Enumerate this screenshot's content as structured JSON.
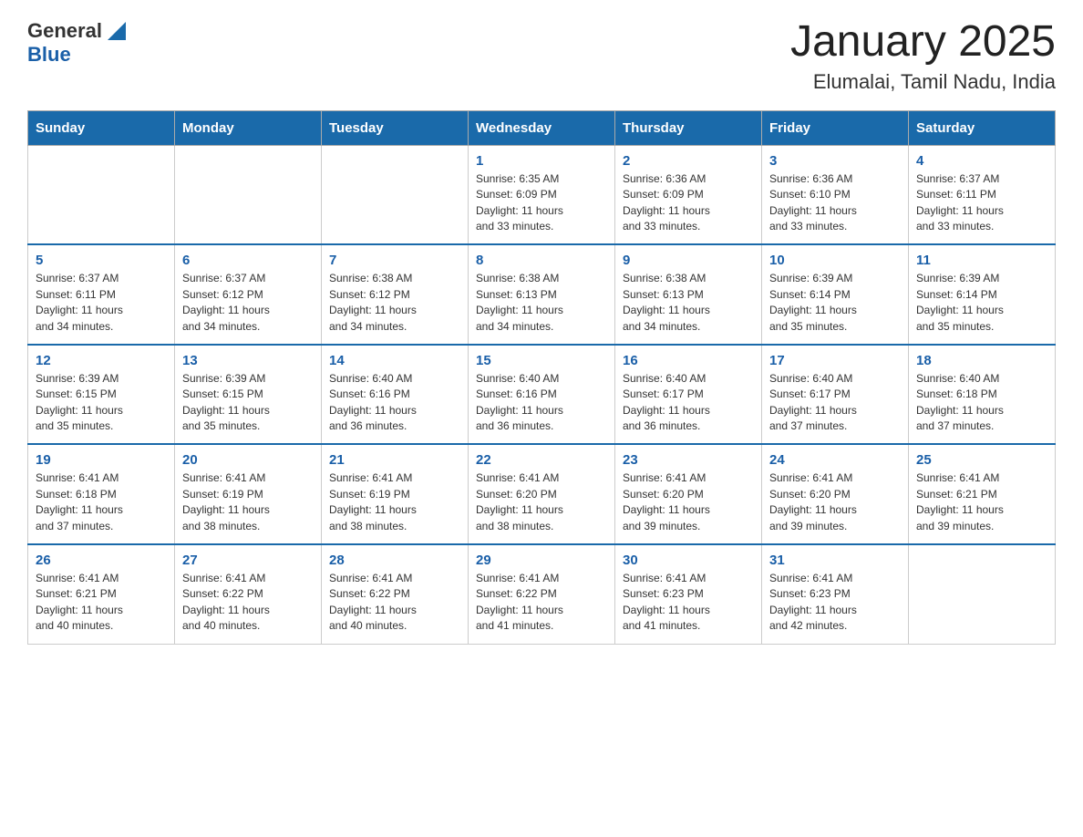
{
  "header": {
    "logo_general": "General",
    "logo_blue": "Blue",
    "title": "January 2025",
    "subtitle": "Elumalai, Tamil Nadu, India"
  },
  "weekdays": [
    "Sunday",
    "Monday",
    "Tuesday",
    "Wednesday",
    "Thursday",
    "Friday",
    "Saturday"
  ],
  "weeks": [
    [
      {
        "day": "",
        "info": ""
      },
      {
        "day": "",
        "info": ""
      },
      {
        "day": "",
        "info": ""
      },
      {
        "day": "1",
        "info": "Sunrise: 6:35 AM\nSunset: 6:09 PM\nDaylight: 11 hours\nand 33 minutes."
      },
      {
        "day": "2",
        "info": "Sunrise: 6:36 AM\nSunset: 6:09 PM\nDaylight: 11 hours\nand 33 minutes."
      },
      {
        "day": "3",
        "info": "Sunrise: 6:36 AM\nSunset: 6:10 PM\nDaylight: 11 hours\nand 33 minutes."
      },
      {
        "day": "4",
        "info": "Sunrise: 6:37 AM\nSunset: 6:11 PM\nDaylight: 11 hours\nand 33 minutes."
      }
    ],
    [
      {
        "day": "5",
        "info": "Sunrise: 6:37 AM\nSunset: 6:11 PM\nDaylight: 11 hours\nand 34 minutes."
      },
      {
        "day": "6",
        "info": "Sunrise: 6:37 AM\nSunset: 6:12 PM\nDaylight: 11 hours\nand 34 minutes."
      },
      {
        "day": "7",
        "info": "Sunrise: 6:38 AM\nSunset: 6:12 PM\nDaylight: 11 hours\nand 34 minutes."
      },
      {
        "day": "8",
        "info": "Sunrise: 6:38 AM\nSunset: 6:13 PM\nDaylight: 11 hours\nand 34 minutes."
      },
      {
        "day": "9",
        "info": "Sunrise: 6:38 AM\nSunset: 6:13 PM\nDaylight: 11 hours\nand 34 minutes."
      },
      {
        "day": "10",
        "info": "Sunrise: 6:39 AM\nSunset: 6:14 PM\nDaylight: 11 hours\nand 35 minutes."
      },
      {
        "day": "11",
        "info": "Sunrise: 6:39 AM\nSunset: 6:14 PM\nDaylight: 11 hours\nand 35 minutes."
      }
    ],
    [
      {
        "day": "12",
        "info": "Sunrise: 6:39 AM\nSunset: 6:15 PM\nDaylight: 11 hours\nand 35 minutes."
      },
      {
        "day": "13",
        "info": "Sunrise: 6:39 AM\nSunset: 6:15 PM\nDaylight: 11 hours\nand 35 minutes."
      },
      {
        "day": "14",
        "info": "Sunrise: 6:40 AM\nSunset: 6:16 PM\nDaylight: 11 hours\nand 36 minutes."
      },
      {
        "day": "15",
        "info": "Sunrise: 6:40 AM\nSunset: 6:16 PM\nDaylight: 11 hours\nand 36 minutes."
      },
      {
        "day": "16",
        "info": "Sunrise: 6:40 AM\nSunset: 6:17 PM\nDaylight: 11 hours\nand 36 minutes."
      },
      {
        "day": "17",
        "info": "Sunrise: 6:40 AM\nSunset: 6:17 PM\nDaylight: 11 hours\nand 37 minutes."
      },
      {
        "day": "18",
        "info": "Sunrise: 6:40 AM\nSunset: 6:18 PM\nDaylight: 11 hours\nand 37 minutes."
      }
    ],
    [
      {
        "day": "19",
        "info": "Sunrise: 6:41 AM\nSunset: 6:18 PM\nDaylight: 11 hours\nand 37 minutes."
      },
      {
        "day": "20",
        "info": "Sunrise: 6:41 AM\nSunset: 6:19 PM\nDaylight: 11 hours\nand 38 minutes."
      },
      {
        "day": "21",
        "info": "Sunrise: 6:41 AM\nSunset: 6:19 PM\nDaylight: 11 hours\nand 38 minutes."
      },
      {
        "day": "22",
        "info": "Sunrise: 6:41 AM\nSunset: 6:20 PM\nDaylight: 11 hours\nand 38 minutes."
      },
      {
        "day": "23",
        "info": "Sunrise: 6:41 AM\nSunset: 6:20 PM\nDaylight: 11 hours\nand 39 minutes."
      },
      {
        "day": "24",
        "info": "Sunrise: 6:41 AM\nSunset: 6:20 PM\nDaylight: 11 hours\nand 39 minutes."
      },
      {
        "day": "25",
        "info": "Sunrise: 6:41 AM\nSunset: 6:21 PM\nDaylight: 11 hours\nand 39 minutes."
      }
    ],
    [
      {
        "day": "26",
        "info": "Sunrise: 6:41 AM\nSunset: 6:21 PM\nDaylight: 11 hours\nand 40 minutes."
      },
      {
        "day": "27",
        "info": "Sunrise: 6:41 AM\nSunset: 6:22 PM\nDaylight: 11 hours\nand 40 minutes."
      },
      {
        "day": "28",
        "info": "Sunrise: 6:41 AM\nSunset: 6:22 PM\nDaylight: 11 hours\nand 40 minutes."
      },
      {
        "day": "29",
        "info": "Sunrise: 6:41 AM\nSunset: 6:22 PM\nDaylight: 11 hours\nand 41 minutes."
      },
      {
        "day": "30",
        "info": "Sunrise: 6:41 AM\nSunset: 6:23 PM\nDaylight: 11 hours\nand 41 minutes."
      },
      {
        "day": "31",
        "info": "Sunrise: 6:41 AM\nSunset: 6:23 PM\nDaylight: 11 hours\nand 42 minutes."
      },
      {
        "day": "",
        "info": ""
      }
    ]
  ]
}
